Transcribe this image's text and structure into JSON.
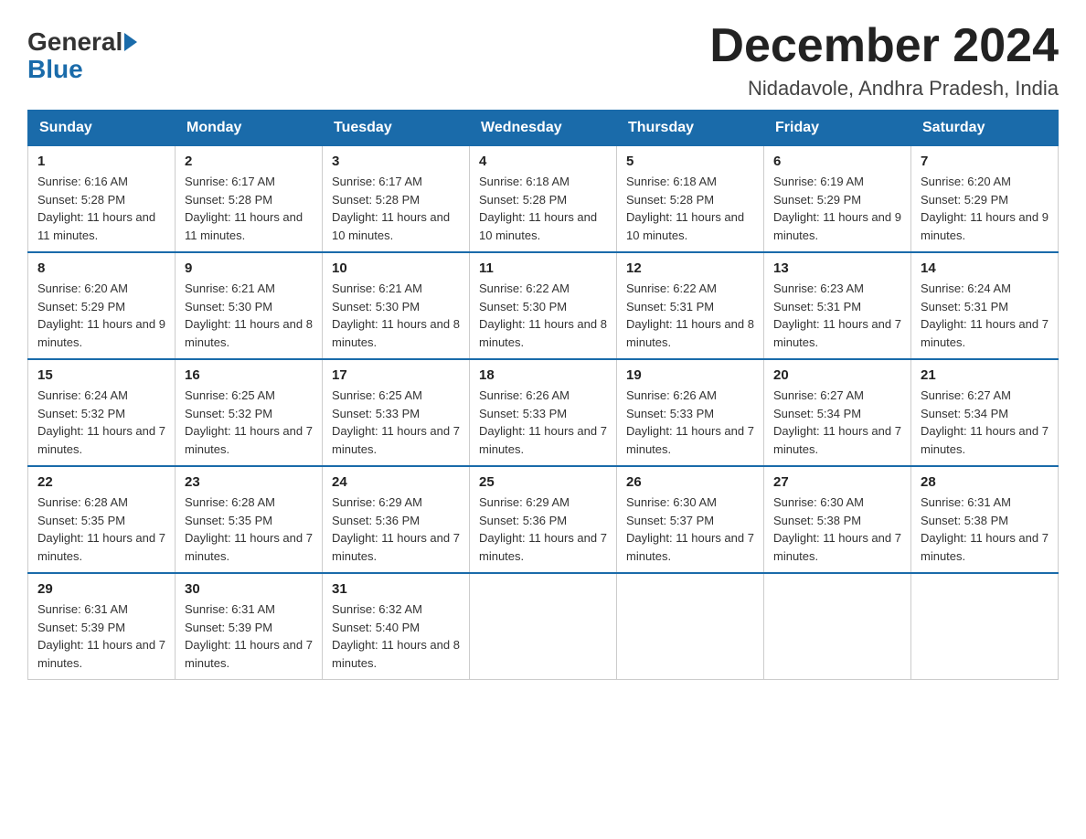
{
  "header": {
    "logo_general": "General",
    "logo_blue": "Blue",
    "title": "December 2024",
    "subtitle": "Nidadavole, Andhra Pradesh, India"
  },
  "weekdays": [
    "Sunday",
    "Monday",
    "Tuesday",
    "Wednesday",
    "Thursday",
    "Friday",
    "Saturday"
  ],
  "weeks": [
    [
      {
        "day": "1",
        "sunrise": "Sunrise: 6:16 AM",
        "sunset": "Sunset: 5:28 PM",
        "daylight": "Daylight: 11 hours and 11 minutes."
      },
      {
        "day": "2",
        "sunrise": "Sunrise: 6:17 AM",
        "sunset": "Sunset: 5:28 PM",
        "daylight": "Daylight: 11 hours and 11 minutes."
      },
      {
        "day": "3",
        "sunrise": "Sunrise: 6:17 AM",
        "sunset": "Sunset: 5:28 PM",
        "daylight": "Daylight: 11 hours and 10 minutes."
      },
      {
        "day": "4",
        "sunrise": "Sunrise: 6:18 AM",
        "sunset": "Sunset: 5:28 PM",
        "daylight": "Daylight: 11 hours and 10 minutes."
      },
      {
        "day": "5",
        "sunrise": "Sunrise: 6:18 AM",
        "sunset": "Sunset: 5:28 PM",
        "daylight": "Daylight: 11 hours and 10 minutes."
      },
      {
        "day": "6",
        "sunrise": "Sunrise: 6:19 AM",
        "sunset": "Sunset: 5:29 PM",
        "daylight": "Daylight: 11 hours and 9 minutes."
      },
      {
        "day": "7",
        "sunrise": "Sunrise: 6:20 AM",
        "sunset": "Sunset: 5:29 PM",
        "daylight": "Daylight: 11 hours and 9 minutes."
      }
    ],
    [
      {
        "day": "8",
        "sunrise": "Sunrise: 6:20 AM",
        "sunset": "Sunset: 5:29 PM",
        "daylight": "Daylight: 11 hours and 9 minutes."
      },
      {
        "day": "9",
        "sunrise": "Sunrise: 6:21 AM",
        "sunset": "Sunset: 5:30 PM",
        "daylight": "Daylight: 11 hours and 8 minutes."
      },
      {
        "day": "10",
        "sunrise": "Sunrise: 6:21 AM",
        "sunset": "Sunset: 5:30 PM",
        "daylight": "Daylight: 11 hours and 8 minutes."
      },
      {
        "day": "11",
        "sunrise": "Sunrise: 6:22 AM",
        "sunset": "Sunset: 5:30 PM",
        "daylight": "Daylight: 11 hours and 8 minutes."
      },
      {
        "day": "12",
        "sunrise": "Sunrise: 6:22 AM",
        "sunset": "Sunset: 5:31 PM",
        "daylight": "Daylight: 11 hours and 8 minutes."
      },
      {
        "day": "13",
        "sunrise": "Sunrise: 6:23 AM",
        "sunset": "Sunset: 5:31 PM",
        "daylight": "Daylight: 11 hours and 7 minutes."
      },
      {
        "day": "14",
        "sunrise": "Sunrise: 6:24 AM",
        "sunset": "Sunset: 5:31 PM",
        "daylight": "Daylight: 11 hours and 7 minutes."
      }
    ],
    [
      {
        "day": "15",
        "sunrise": "Sunrise: 6:24 AM",
        "sunset": "Sunset: 5:32 PM",
        "daylight": "Daylight: 11 hours and 7 minutes."
      },
      {
        "day": "16",
        "sunrise": "Sunrise: 6:25 AM",
        "sunset": "Sunset: 5:32 PM",
        "daylight": "Daylight: 11 hours and 7 minutes."
      },
      {
        "day": "17",
        "sunrise": "Sunrise: 6:25 AM",
        "sunset": "Sunset: 5:33 PM",
        "daylight": "Daylight: 11 hours and 7 minutes."
      },
      {
        "day": "18",
        "sunrise": "Sunrise: 6:26 AM",
        "sunset": "Sunset: 5:33 PM",
        "daylight": "Daylight: 11 hours and 7 minutes."
      },
      {
        "day": "19",
        "sunrise": "Sunrise: 6:26 AM",
        "sunset": "Sunset: 5:33 PM",
        "daylight": "Daylight: 11 hours and 7 minutes."
      },
      {
        "day": "20",
        "sunrise": "Sunrise: 6:27 AM",
        "sunset": "Sunset: 5:34 PM",
        "daylight": "Daylight: 11 hours and 7 minutes."
      },
      {
        "day": "21",
        "sunrise": "Sunrise: 6:27 AM",
        "sunset": "Sunset: 5:34 PM",
        "daylight": "Daylight: 11 hours and 7 minutes."
      }
    ],
    [
      {
        "day": "22",
        "sunrise": "Sunrise: 6:28 AM",
        "sunset": "Sunset: 5:35 PM",
        "daylight": "Daylight: 11 hours and 7 minutes."
      },
      {
        "day": "23",
        "sunrise": "Sunrise: 6:28 AM",
        "sunset": "Sunset: 5:35 PM",
        "daylight": "Daylight: 11 hours and 7 minutes."
      },
      {
        "day": "24",
        "sunrise": "Sunrise: 6:29 AM",
        "sunset": "Sunset: 5:36 PM",
        "daylight": "Daylight: 11 hours and 7 minutes."
      },
      {
        "day": "25",
        "sunrise": "Sunrise: 6:29 AM",
        "sunset": "Sunset: 5:36 PM",
        "daylight": "Daylight: 11 hours and 7 minutes."
      },
      {
        "day": "26",
        "sunrise": "Sunrise: 6:30 AM",
        "sunset": "Sunset: 5:37 PM",
        "daylight": "Daylight: 11 hours and 7 minutes."
      },
      {
        "day": "27",
        "sunrise": "Sunrise: 6:30 AM",
        "sunset": "Sunset: 5:38 PM",
        "daylight": "Daylight: 11 hours and 7 minutes."
      },
      {
        "day": "28",
        "sunrise": "Sunrise: 6:31 AM",
        "sunset": "Sunset: 5:38 PM",
        "daylight": "Daylight: 11 hours and 7 minutes."
      }
    ],
    [
      {
        "day": "29",
        "sunrise": "Sunrise: 6:31 AM",
        "sunset": "Sunset: 5:39 PM",
        "daylight": "Daylight: 11 hours and 7 minutes."
      },
      {
        "day": "30",
        "sunrise": "Sunrise: 6:31 AM",
        "sunset": "Sunset: 5:39 PM",
        "daylight": "Daylight: 11 hours and 7 minutes."
      },
      {
        "day": "31",
        "sunrise": "Sunrise: 6:32 AM",
        "sunset": "Sunset: 5:40 PM",
        "daylight": "Daylight: 11 hours and 8 minutes."
      },
      null,
      null,
      null,
      null
    ]
  ]
}
